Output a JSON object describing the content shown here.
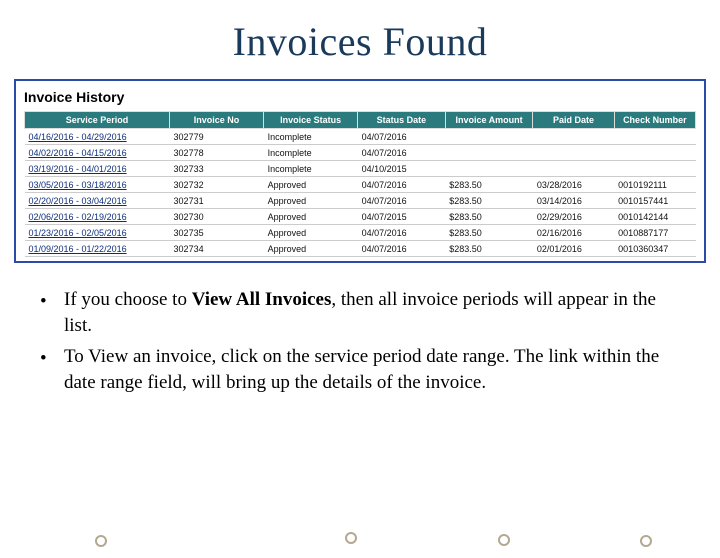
{
  "title": "Invoices Found",
  "panel": {
    "heading": "Invoice History"
  },
  "columns": {
    "service_period": "Service Period",
    "invoice_no": "Invoice No",
    "invoice_status": "Invoice Status",
    "status_date": "Status Date",
    "invoice_amount": "Invoice Amount",
    "paid_date": "Paid Date",
    "check_number": "Check Number"
  },
  "rows": [
    {
      "service_period": "04/16/2016 - 04/29/2016",
      "invoice_no": "302779",
      "invoice_status": "Incomplete",
      "status_date": "04/07/2016",
      "invoice_amount": "",
      "paid_date": "",
      "check_number": ""
    },
    {
      "service_period": "04/02/2016 - 04/15/2016",
      "invoice_no": "302778",
      "invoice_status": "Incomplete",
      "status_date": "04/07/2016",
      "invoice_amount": "",
      "paid_date": "",
      "check_number": ""
    },
    {
      "service_period": "03/19/2016 - 04/01/2016",
      "invoice_no": "302733",
      "invoice_status": "Incomplete",
      "status_date": "04/10/2015",
      "invoice_amount": "",
      "paid_date": "",
      "check_number": ""
    },
    {
      "service_period": "03/05/2016 - 03/18/2016",
      "invoice_no": "302732",
      "invoice_status": "Approved",
      "status_date": "04/07/2016",
      "invoice_amount": "$283.50",
      "paid_date": "03/28/2016",
      "check_number": "0010192111"
    },
    {
      "service_period": "02/20/2016 - 03/04/2016",
      "invoice_no": "302731",
      "invoice_status": "Approved",
      "status_date": "04/07/2016",
      "invoice_amount": "$283.50",
      "paid_date": "03/14/2016",
      "check_number": "0010157441"
    },
    {
      "service_period": "02/06/2016 - 02/19/2016",
      "invoice_no": "302730",
      "invoice_status": "Approved",
      "status_date": "04/07/2015",
      "invoice_amount": "$283.50",
      "paid_date": "02/29/2016",
      "check_number": "0010142144"
    },
    {
      "service_period": "01/23/2016 - 02/05/2016",
      "invoice_no": "302735",
      "invoice_status": "Approved",
      "status_date": "04/07/2016",
      "invoice_amount": "$283.50",
      "paid_date": "02/16/2016",
      "check_number": "0010887177"
    },
    {
      "service_period": "01/09/2016 - 01/22/2016",
      "invoice_no": "302734",
      "invoice_status": "Approved",
      "status_date": "04/07/2016",
      "invoice_amount": "$283.50",
      "paid_date": "02/01/2016",
      "check_number": "0010360347"
    }
  ],
  "bullets": {
    "b1_pre": "If you choose to ",
    "b1_bold": "View All Invoices",
    "b1_post": ", then all invoice periods will appear in the list.",
    "b2": "To View an invoice, click on the service period date range. The link within the date range field, will bring up the details of the invoice."
  }
}
